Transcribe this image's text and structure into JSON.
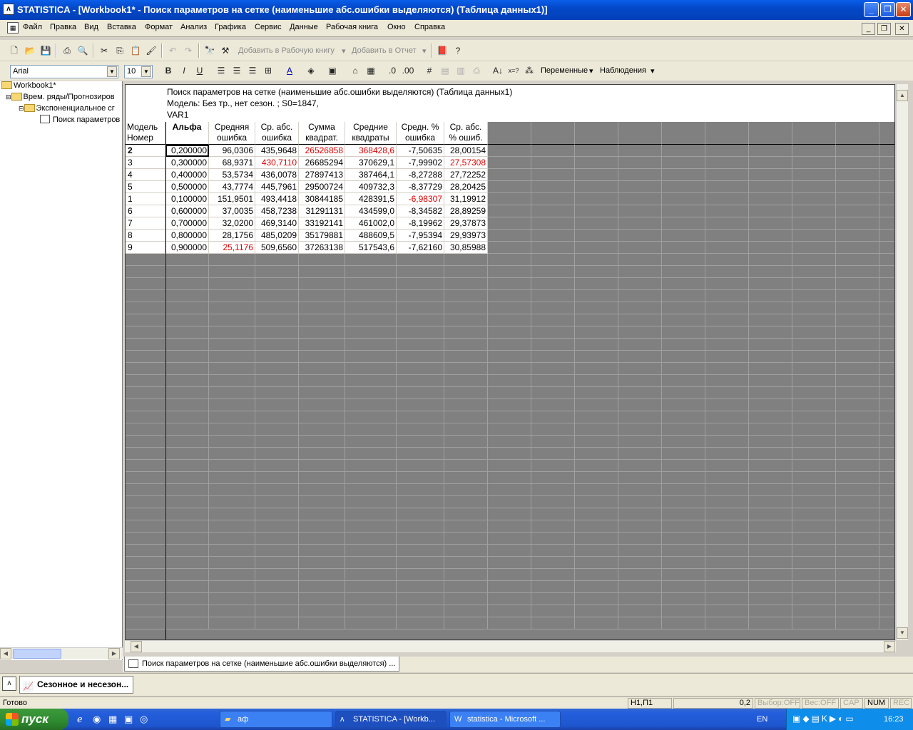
{
  "window": {
    "title": "STATISTICA - [Workbook1* - Поиск параметров на сетке (наименьшие абс.ошибки выделяются) (Таблица данных1)]"
  },
  "menu": [
    "Файл",
    "Правка",
    "Вид",
    "Вставка",
    "Формат",
    "Анализ",
    "Графика",
    "Сервис",
    "Данные",
    "Рабочая книга",
    "Окно",
    "Справка"
  ],
  "toolbar1": {
    "add_workbook": "Добавить в Рабочую книгу",
    "add_report": "Добавить в Отчет"
  },
  "toolbar2": {
    "font": "Arial",
    "size": "10",
    "variables": "Переменные",
    "observations": "Наблюдения"
  },
  "tree": {
    "root": "Workbook1*",
    "node1": "Врем. ряды/Прогнозиров",
    "node2": "Экспоненциальное сг",
    "leaf": "Поиск параметров"
  },
  "table": {
    "header_lines": [
      "Поиск параметров на сетке (наименьшие абс.ошибки выделяются) (Таблица данных1)",
      "Модель: Без тр., нет сезон. ; S0=1847,",
      "VAR1"
    ],
    "rowheader_title": [
      "Модель",
      "Номер"
    ],
    "columns": [
      [
        "Альфа",
        ""
      ],
      [
        "Средняя",
        "ошибка"
      ],
      [
        "Ср. абс.",
        "ошибка"
      ],
      [
        "Сумма",
        "квадрат."
      ],
      [
        "Средние",
        "квадраты"
      ],
      [
        "Средн. %",
        "ошибка"
      ],
      [
        "Ср. абс.",
        "% ошиб."
      ]
    ],
    "rows": [
      {
        "id": "2",
        "cells": [
          "0,200000",
          "96,0306",
          "435,9648",
          "26526858",
          "368428,6",
          "-7,50635",
          "28,00154"
        ]
      },
      {
        "id": "3",
        "cells": [
          "0,300000",
          "68,9371",
          "430,7110",
          "26685294",
          "370629,1",
          "-7,99902",
          "27,57308"
        ]
      },
      {
        "id": "4",
        "cells": [
          "0,400000",
          "53,5734",
          "436,0078",
          "27897413",
          "387464,1",
          "-8,27288",
          "27,72252"
        ]
      },
      {
        "id": "5",
        "cells": [
          "0,500000",
          "43,7774",
          "445,7961",
          "29500724",
          "409732,3",
          "-8,37729",
          "28,20425"
        ]
      },
      {
        "id": "1",
        "cells": [
          "0,100000",
          "151,9501",
          "493,4418",
          "30844185",
          "428391,5",
          "-6,98307",
          "31,19912"
        ]
      },
      {
        "id": "6",
        "cells": [
          "0,600000",
          "37,0035",
          "458,7238",
          "31291131",
          "434599,0",
          "-8,34582",
          "28,89259"
        ]
      },
      {
        "id": "7",
        "cells": [
          "0,700000",
          "32,0200",
          "469,3140",
          "33192141",
          "461002,0",
          "-8,19962",
          "29,37873"
        ]
      },
      {
        "id": "8",
        "cells": [
          "0,800000",
          "28,1756",
          "485,0209",
          "35179881",
          "488609,5",
          "-7,95394",
          "29,93973"
        ]
      },
      {
        "id": "9",
        "cells": [
          "0,900000",
          "25,1176",
          "509,6560",
          "37263138",
          "517543,6",
          "-7,62160",
          "30,85988"
        ]
      }
    ],
    "highlight": [
      [
        0,
        3
      ],
      [
        0,
        4
      ],
      [
        1,
        2
      ],
      [
        1,
        6
      ],
      [
        4,
        5
      ],
      [
        8,
        1
      ]
    ]
  },
  "tab": {
    "label": "Поиск параметров на сетке (наименьшие абс.ошибки выделяются) ..."
  },
  "report": {
    "label": "Сезонное и несезон..."
  },
  "status": {
    "ready": "Готово",
    "cell": "H1,П1",
    "value": "0,2",
    "sel": "Выбор:OFF",
    "weight": "Вес:OFF",
    "cap": "CAP",
    "num": "NUM",
    "rec": "REC"
  },
  "taskbar": {
    "start": "пуск",
    "items": [
      "аф",
      "STATISTICA - [Workb...",
      "statistica - Microsoft ..."
    ],
    "lang": "EN",
    "clock": "16:23"
  }
}
